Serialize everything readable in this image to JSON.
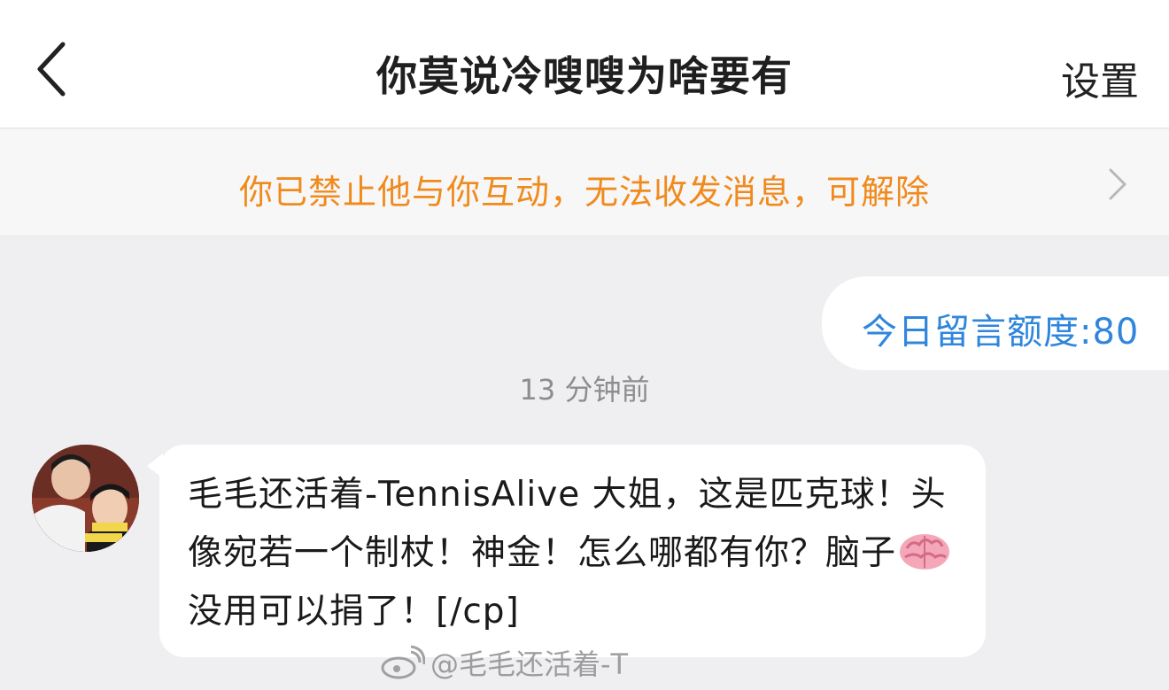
{
  "header": {
    "title": "你莫说冷嗖嗖为啥要有",
    "settings_label": "设置"
  },
  "notice": {
    "text": "你已禁止他与你互动，无法收发消息，可解除"
  },
  "messages": {
    "outgoing_quota": "今日留言额度:80",
    "timestamp": "13 分钟前",
    "incoming_part1": "毛毛还活着-TennisAlive 大姐，这是匹克球！头像宛若一个制杖！神金！怎么哪都有你？脑子",
    "incoming_part2": "没用可以捐了！[/cp]"
  },
  "watermark": {
    "text": "@毛毛还活着-T"
  },
  "icons": {
    "back": "chevron-left-icon",
    "notice_arrow": "chevron-right-icon",
    "brain": "brain-emoji-icon"
  },
  "colors": {
    "notice_orange": "#f08a1d",
    "quota_blue": "#2f86dc"
  }
}
